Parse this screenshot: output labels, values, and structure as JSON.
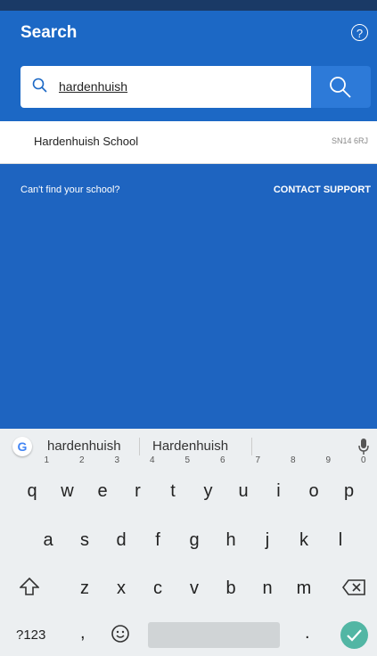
{
  "header": {
    "title": "Search"
  },
  "search": {
    "value": "hardenhuish"
  },
  "result": {
    "name": "Hardenhuish School",
    "postcode": "SN14 6RJ"
  },
  "support": {
    "prompt": "Can't find your school?",
    "link": "CONTACT SUPPORT"
  },
  "keyboard": {
    "suggestions": [
      "hardenhuish",
      "Hardenhuish"
    ],
    "row1": [
      {
        "k": "q",
        "n": "1"
      },
      {
        "k": "w",
        "n": "2"
      },
      {
        "k": "e",
        "n": "3"
      },
      {
        "k": "r",
        "n": "4"
      },
      {
        "k": "t",
        "n": "5"
      },
      {
        "k": "y",
        "n": "6"
      },
      {
        "k": "u",
        "n": "7"
      },
      {
        "k": "i",
        "n": "8"
      },
      {
        "k": "o",
        "n": "9"
      },
      {
        "k": "p",
        "n": "0"
      }
    ],
    "row2": [
      "a",
      "s",
      "d",
      "f",
      "g",
      "h",
      "j",
      "k",
      "l"
    ],
    "row3": [
      "z",
      "x",
      "c",
      "v",
      "b",
      "n",
      "m"
    ],
    "symbols_label": "?123",
    "comma": ",",
    "period": "."
  },
  "colors": {
    "primary": "#1c68c5",
    "search_button": "#2d7ad8",
    "enter_key": "#52b6a4"
  },
  "icons": [
    "help-icon",
    "search-icon",
    "google-icon",
    "mic-icon",
    "shift-icon",
    "backspace-icon",
    "emoji-icon",
    "check-icon"
  ]
}
